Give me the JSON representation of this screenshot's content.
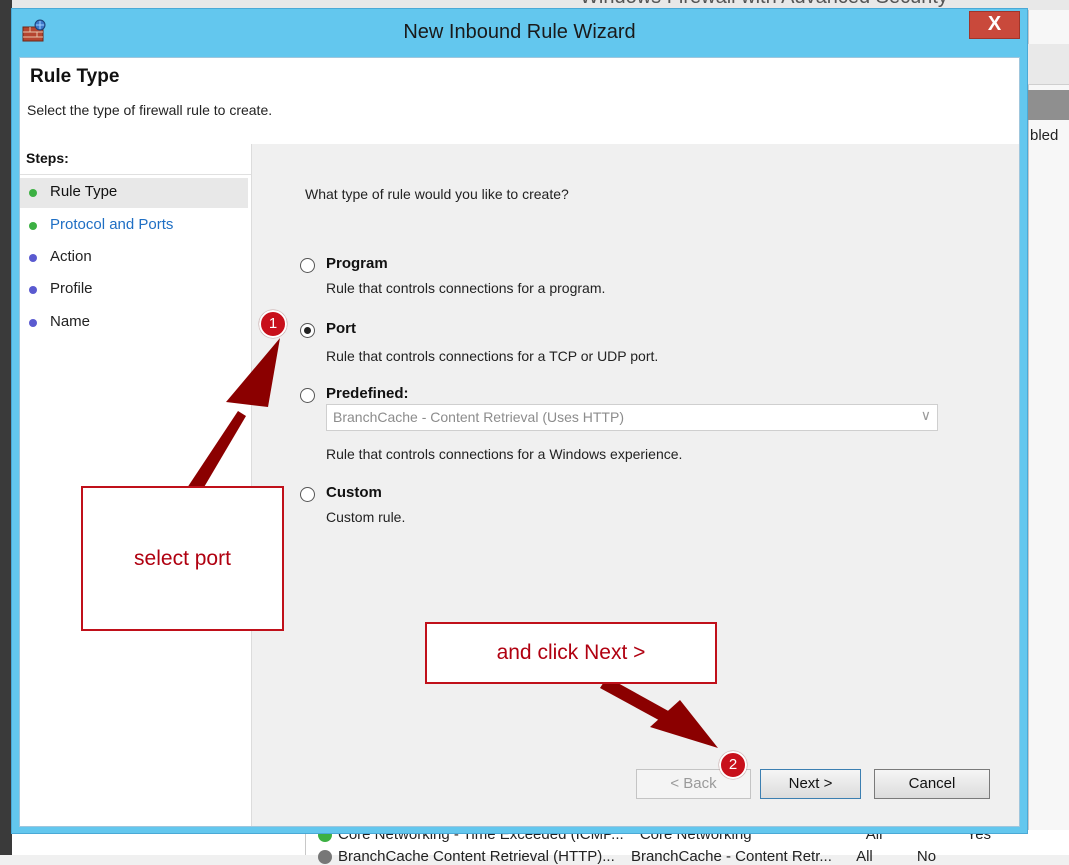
{
  "background": {
    "window_title": "Windows Firewall with Advanced Security",
    "column_fragment": "bled",
    "rows": [
      {
        "name": "Core Networking - Time Exceeded (ICMP...",
        "group": "Core Networking",
        "profile": "All",
        "enabled": "Yes"
      },
      {
        "name": "BranchCache Content Retrieval (HTTP)...",
        "group": "BranchCache - Content Retr...",
        "profile": "All",
        "enabled": "No"
      }
    ]
  },
  "dialog": {
    "title": "New Inbound Rule Wizard",
    "close_label": "X",
    "header": {
      "title": "Rule Type",
      "subtitle": "Select the type of firewall rule to create."
    },
    "steps": {
      "title": "Steps:",
      "items": [
        {
          "label": "Rule Type",
          "status": "complete",
          "current": true
        },
        {
          "label": "Protocol and Ports",
          "status": "complete",
          "current": false
        },
        {
          "label": "Action",
          "status": "pending",
          "current": false
        },
        {
          "label": "Profile",
          "status": "pending",
          "current": false
        },
        {
          "label": "Name",
          "status": "pending",
          "current": false
        }
      ]
    },
    "question": "What type of rule would you like to create?",
    "options": [
      {
        "label": "Program",
        "description": "Rule that controls connections for a program.",
        "selected": false
      },
      {
        "label": "Port",
        "description": "Rule that controls connections for a TCP or UDP port.",
        "selected": true
      },
      {
        "label": "Predefined:",
        "description": "Rule that controls connections for a Windows experience.",
        "selected": false
      },
      {
        "label": "Custom",
        "description": "Custom rule.",
        "selected": false
      }
    ],
    "predefined_select": {
      "value": "BranchCache - Content Retrieval (Uses HTTP)",
      "disabled": true
    },
    "buttons": {
      "back": "< Back",
      "next": "Next >",
      "cancel": "Cancel"
    }
  },
  "annotations": {
    "marker1": "1",
    "marker2": "2",
    "callout1": "select port",
    "callout2": "and click Next >"
  },
  "colors": {
    "title_bar": "#63c7ee",
    "close_button": "#c9493b",
    "step_complete": "#3cb043",
    "step_pending": "#5a5ad0",
    "step_link": "#1f6fc4",
    "annotation": "#c0101a"
  }
}
